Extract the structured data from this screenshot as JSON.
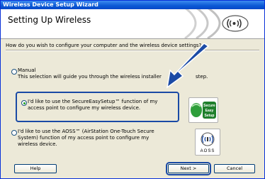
{
  "window": {
    "title": "Wireless Device Setup Wizard"
  },
  "header": {
    "title": "Setting Up Wireless"
  },
  "question": "How do you wish to configure your computer and the wireless device settings?",
  "options": [
    {
      "line1": "Manual",
      "line2": "This selection will guide you through the wireless installer",
      "line2b": "step.",
      "checked": false
    },
    {
      "line1": "I'd like to use the SecureEasySetup™ function of my",
      "line2": "access point to configure my wireless device.",
      "checked": true
    },
    {
      "line1": "I'd like to use the AOSS™ (AirStation One-Touch Secure",
      "line2": "System) function of my access point to configure my",
      "line3": "wireless device.",
      "checked": false
    }
  ],
  "logos": {
    "ses": {
      "l1": "Secure",
      "l2": "Easy",
      "l3": "Setup"
    },
    "aoss": {
      "text": "AOSS"
    }
  },
  "buttons": {
    "help": "Help",
    "next": "Next >",
    "cancel": "Cancel"
  },
  "colors": {
    "accent": "#1a4aa5",
    "titlebar": "#0a58d4"
  }
}
